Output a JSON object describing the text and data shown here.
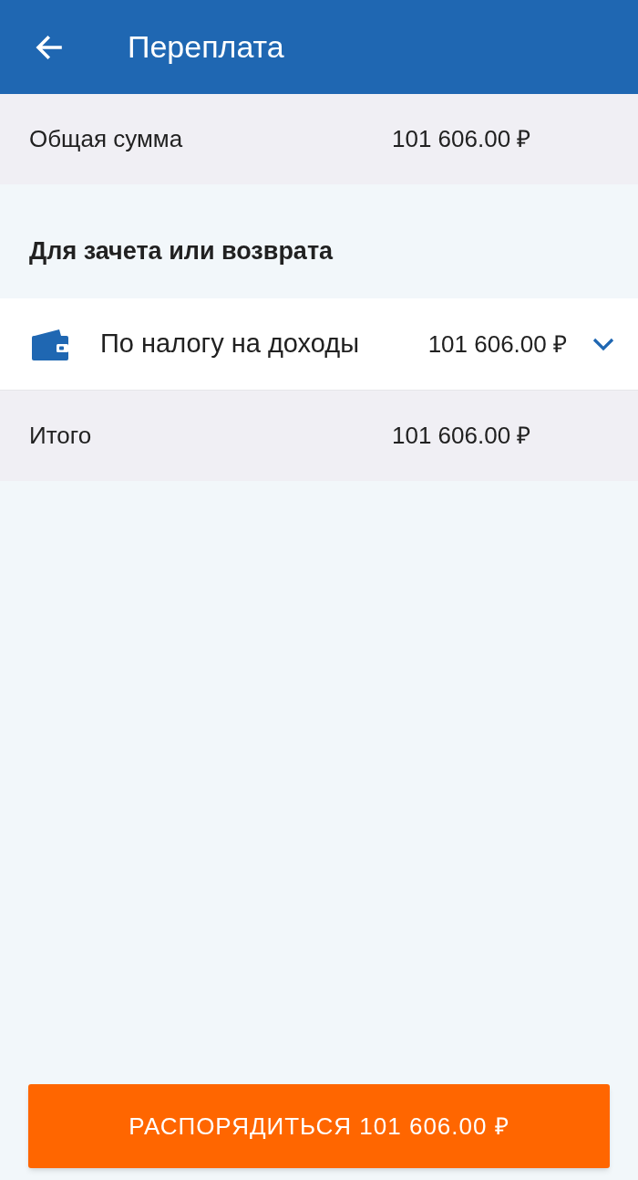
{
  "header": {
    "title": "Переплата"
  },
  "total_row": {
    "label": "Общая сумма",
    "amount": "101 606.00 ₽"
  },
  "section": {
    "title": "Для зачета или возврата",
    "items": [
      {
        "label": "По налогу на доходы",
        "amount": "101 606.00 ₽",
        "expanded": false
      }
    ]
  },
  "summary_row": {
    "label": "Итого",
    "amount": "101 606.00 ₽"
  },
  "action_button": {
    "label": "РАСПОРЯДИТЬСЯ 101 606.00 ₽"
  }
}
